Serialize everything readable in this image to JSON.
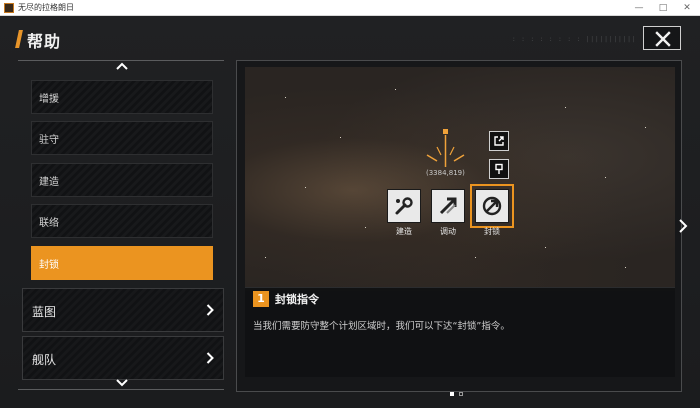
{
  "window": {
    "title": "无尽的拉格朗日"
  },
  "header": {
    "title": "帮助",
    "decoration": ": : : : : : : : |||||||||||"
  },
  "sidebar": {
    "sub_items": [
      {
        "label": "增援"
      },
      {
        "label": "驻守"
      },
      {
        "label": "建造"
      },
      {
        "label": "联络"
      },
      {
        "label": "封锁"
      }
    ],
    "active_index": 4,
    "categories": [
      {
        "label": "蓝图"
      },
      {
        "label": "舰队"
      }
    ]
  },
  "preview": {
    "coordinates": "(3384,819)",
    "actions": [
      {
        "label": "建造",
        "icon": "wrench-icon"
      },
      {
        "label": "调动",
        "icon": "move-arrow-icon"
      },
      {
        "label": "封锁",
        "icon": "blockade-icon"
      }
    ],
    "small_buttons": [
      {
        "icon": "share-icon"
      },
      {
        "icon": "flag-marker-icon"
      }
    ]
  },
  "caption": {
    "step_number": "1",
    "title": "封锁指令",
    "description": "当我们需要防守整个计划区域时，我们可以下达“封锁”指令。"
  },
  "pagination": {
    "current": 1,
    "total": 2
  },
  "colors": {
    "accent": "#eb9420",
    "background": "#1c1d1f",
    "panel": "#111214"
  }
}
